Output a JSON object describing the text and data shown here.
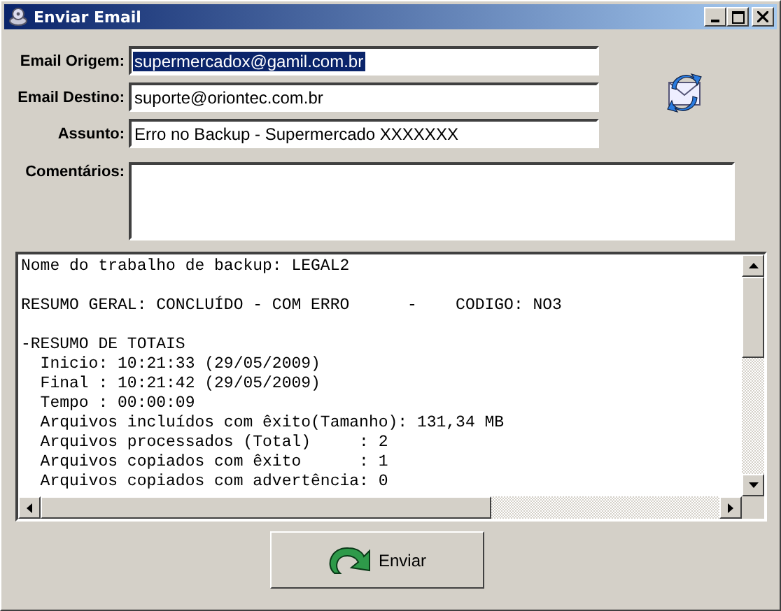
{
  "window": {
    "title": "Enviar Email"
  },
  "fields": [
    {
      "label": "Email Origem:",
      "value": "supermercadox@gamil.com.br",
      "selected": true
    },
    {
      "label": "Email Destino:",
      "value": "suporte@oriontec.com.br",
      "selected": false
    },
    {
      "label": "Assunto:",
      "value": "Erro no Backup - Supermercado XXXXXXX",
      "selected": false
    }
  ],
  "comments": {
    "label": "Comentários:"
  },
  "log_paragraphs": [
    {
      "lines": [
        "Nome do trabalho de backup: LEGAL2"
      ]
    },
    {
      "lines": [
        "RESUMO GERAL: CONCLUÍDO - COM ERRO      -    CODIGO: NO3"
      ]
    },
    {
      "lines": [
        "-RESUMO DE TOTAIS",
        "  Inicio: 10:21:33 (29/05/2009)",
        "  Final : 10:21:42 (29/05/2009)",
        "  Tempo : 00:00:09",
        "  Arquivos incluídos com êxito(Tamanho): 131,34 MB",
        "  Arquivos processados (Total)     : 2",
        "  Arquivos copiados com êxito      : 1",
        "  Arquivos copiados com advertência: 0"
      ]
    }
  ],
  "send_button": {
    "label": "Enviar"
  }
}
